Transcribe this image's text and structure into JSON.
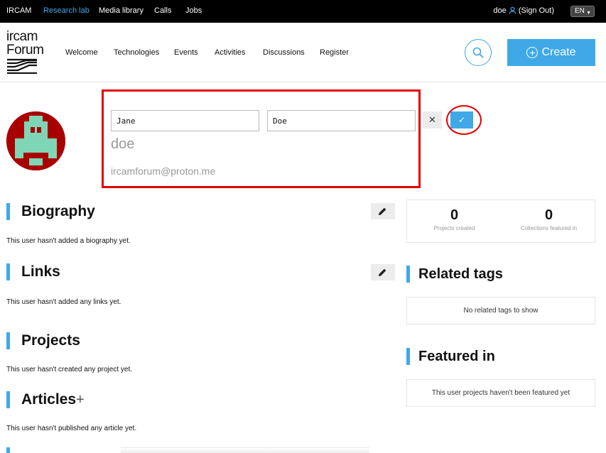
{
  "topbar": {
    "links": [
      "IRCAM",
      "Research lab",
      "Media library",
      "Calls",
      "Jobs"
    ],
    "active": "Research lab",
    "username": "doe",
    "signout": "(Sign Out)",
    "language": "EN"
  },
  "header": {
    "logo_line1": "ircam",
    "logo_line2": "Forum",
    "nav": [
      "Welcome",
      "Technologies",
      "Events",
      "Activities",
      "Discussions",
      "Register"
    ],
    "create_label": "Create"
  },
  "profile": {
    "first_name": "Jane",
    "last_name": "Doe",
    "username": "doe",
    "email": "ircamforum@proton.me"
  },
  "sections": {
    "biography": {
      "title": "Biography",
      "text": "This user hasn't added a biography yet."
    },
    "links": {
      "title": "Links",
      "text": "This user hasn't added any links yet."
    },
    "projects": {
      "title": "Projects",
      "text": "This user hasn't created any project yet."
    },
    "articles": {
      "title": "Articles",
      "text": "This user hasn't published any article yet."
    }
  },
  "stats": {
    "projects_created": "0",
    "projects_created_label": "Projects created",
    "collections_featured": "0",
    "collections_featured_label": "Collections featured in"
  },
  "sidebar": {
    "related_tags_title": "Related tags",
    "related_tags_empty": "No related tags to show",
    "featured_title": "Featured in",
    "featured_empty": "This user projects haven't been featured yet"
  },
  "colors": {
    "accent": "#3fa9e8",
    "highlight": "#e00000",
    "avatar_bg": "#a80000",
    "avatar_fg": "#7fd6b6"
  }
}
